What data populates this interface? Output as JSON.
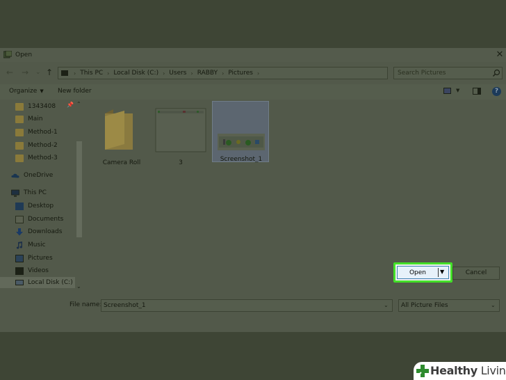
{
  "window": {
    "title": "Open",
    "close_label": "✕"
  },
  "nav": {
    "back": "←",
    "forward": "→",
    "recent": "⌄",
    "up": "↑",
    "breadcrumbs": [
      "This PC",
      "Local Disk (C:)",
      "Users",
      "RABBY",
      "Pictures"
    ],
    "breadcrumb_sep": "›",
    "dropdown": "⌄",
    "refresh": "↻"
  },
  "search": {
    "placeholder": "Search Pictures"
  },
  "toolbar": {
    "organize": "Organize",
    "organize_caret": "▼",
    "new_folder": "New folder",
    "view_caret": "▼",
    "help": "?"
  },
  "sidebar": {
    "items": [
      {
        "label": "1343408",
        "icon": "folder-icon"
      },
      {
        "label": "Main",
        "icon": "folder-icon"
      },
      {
        "label": "Method-1",
        "icon": "folder-icon"
      },
      {
        "label": "Method-2",
        "icon": "folder-icon"
      },
      {
        "label": "Method-3",
        "icon": "folder-icon"
      },
      {
        "label": "OneDrive",
        "icon": "cloud-icon"
      },
      {
        "label": "This PC",
        "icon": "computer-icon"
      },
      {
        "label": "Desktop",
        "icon": "desktop-icon"
      },
      {
        "label": "Documents",
        "icon": "documents-icon"
      },
      {
        "label": "Downloads",
        "icon": "downloads-icon"
      },
      {
        "label": "Music",
        "icon": "music-icon"
      },
      {
        "label": "Pictures",
        "icon": "pictures-icon"
      },
      {
        "label": "Videos",
        "icon": "videos-icon"
      },
      {
        "label": "Local Disk (C:)",
        "icon": "drive-icon",
        "selected": true
      }
    ],
    "scroll_up": "⌃",
    "scroll_down": "⌄",
    "pin": "📌"
  },
  "files": [
    {
      "label": "Camera Roll",
      "type": "folder"
    },
    {
      "label": "3",
      "type": "image"
    },
    {
      "label": "Screenshot_1",
      "type": "image",
      "selected": true
    }
  ],
  "bottom": {
    "file_name_label": "File name:",
    "file_name_value": "Screenshot_1",
    "file_type": "All Picture Files",
    "drop": "⌄",
    "open_label": "Open",
    "open_caret": "▼",
    "cancel_label": "Cancel"
  },
  "watermark": {
    "bold": "Healthy",
    "light": " Living"
  },
  "colors": {
    "highlight": "#43e028",
    "backdrop": "#3e4535",
    "dialog": "#52594a"
  }
}
